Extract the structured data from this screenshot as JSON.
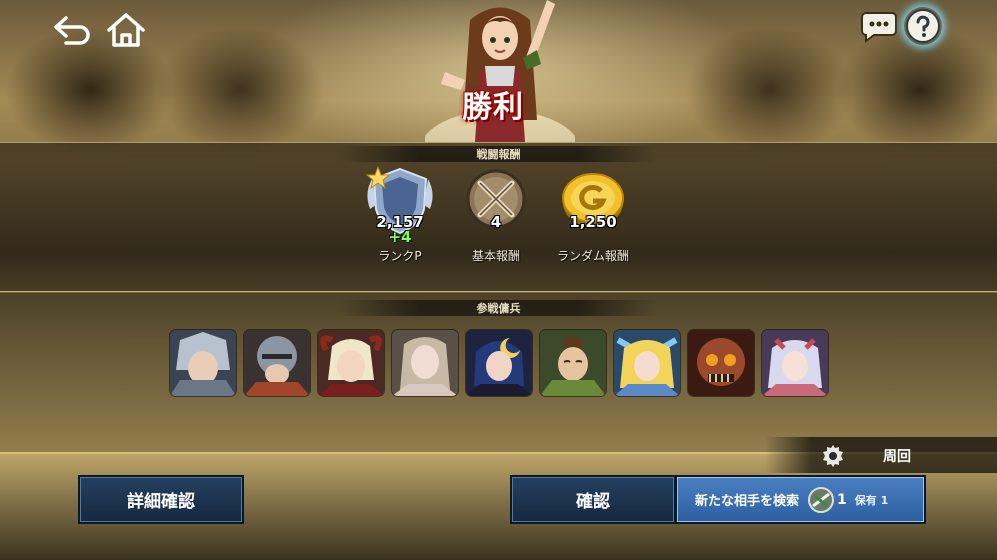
{
  "header": {
    "victory_label": "勝利"
  },
  "battle_rewards": {
    "title": "戦闘報酬",
    "items": [
      {
        "label": "ランクP",
        "value": "2,157",
        "delta": "+4"
      },
      {
        "label": "基本報酬",
        "value": "4"
      },
      {
        "label": "ランダム報酬",
        "value": "1,250"
      }
    ]
  },
  "participants": {
    "title": "参戦傭兵",
    "units": [
      {
        "icon": "silver-knight-portrait"
      },
      {
        "icon": "armored-knight-portrait"
      },
      {
        "icon": "horned-girl-portrait"
      },
      {
        "icon": "pale-woman-portrait"
      },
      {
        "icon": "moon-witch-portrait"
      },
      {
        "icon": "monk-portrait"
      },
      {
        "icon": "blonde-valkyrie-portrait"
      },
      {
        "icon": "mechanical-demon-portrait"
      },
      {
        "icon": "silver-haired-girl-portrait"
      }
    ]
  },
  "loop": {
    "label": "周回"
  },
  "buttons": {
    "detail": "詳細確認",
    "confirm": "確認",
    "search": "新たな相手を検索",
    "search_count": "1",
    "owned": "保有 1"
  },
  "colors": {
    "accent": "#4a80c2",
    "button_dark": "#1d3450",
    "delta_green": "#7dff5a",
    "victory_red": "#b30000"
  }
}
